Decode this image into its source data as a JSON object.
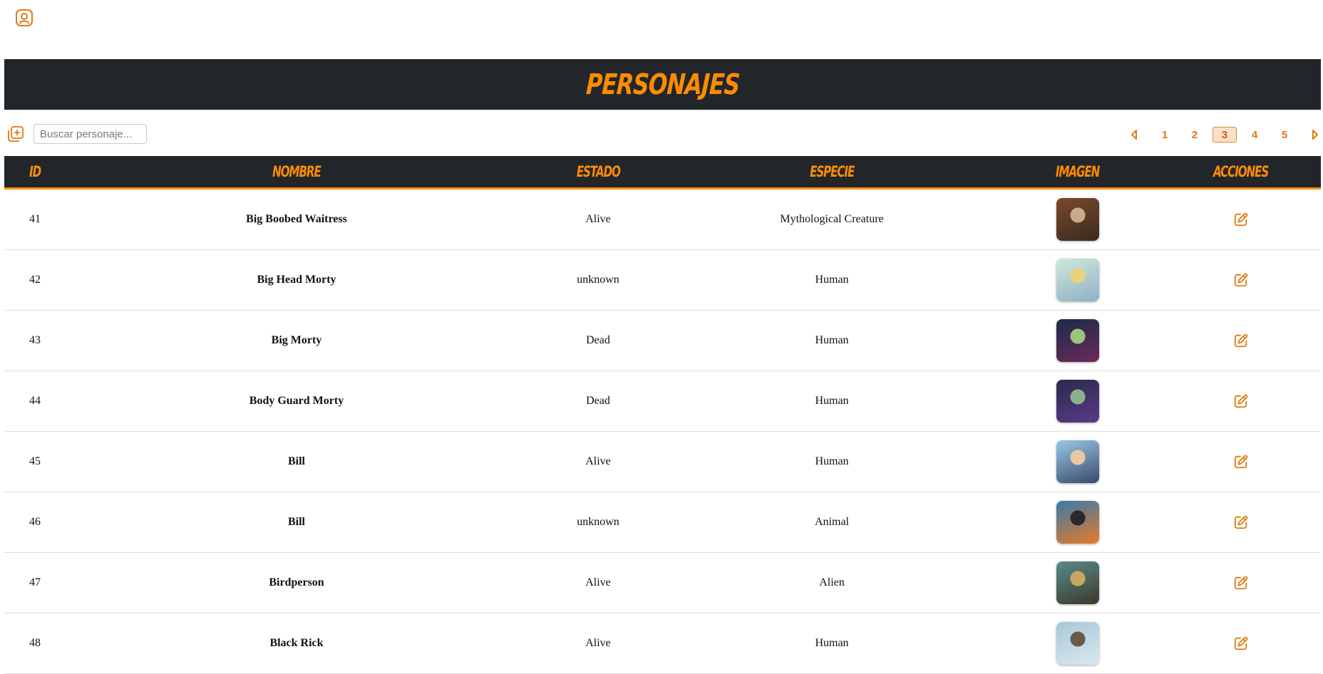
{
  "header": {
    "title": "Personajes"
  },
  "toolbar": {
    "search_placeholder": "Buscar personaje...",
    "search_value": ""
  },
  "pagination": {
    "pages": [
      "1",
      "2",
      "3",
      "4",
      "5"
    ],
    "current": "3"
  },
  "table": {
    "columns": [
      "ID",
      "Nombre",
      "Estado",
      "Especie",
      "Imagen",
      "Acciones"
    ],
    "rows": [
      {
        "id": "41",
        "name": "Big Boobed Waitress",
        "status": "Alive",
        "species": "Mythological Creature",
        "thumb": [
          "#7a4a2a",
          "#c9a98a",
          "#3a2a20"
        ]
      },
      {
        "id": "42",
        "name": "Big Head Morty",
        "status": "unknown",
        "species": "Human",
        "thumb": [
          "#cfe8d8",
          "#e8d27a",
          "#8fb0c9"
        ]
      },
      {
        "id": "43",
        "name": "Big Morty",
        "status": "Dead",
        "species": "Human",
        "thumb": [
          "#1c2a4a",
          "#9ac47a",
          "#6a2a5a"
        ]
      },
      {
        "id": "44",
        "name": "Body Guard Morty",
        "status": "Dead",
        "species": "Human",
        "thumb": [
          "#2a2a4a",
          "#8ab08a",
          "#5a3a8a"
        ]
      },
      {
        "id": "45",
        "name": "Bill",
        "status": "Alive",
        "species": "Human",
        "thumb": [
          "#9ac8e8",
          "#e8c8a0",
          "#3a4a6a"
        ]
      },
      {
        "id": "46",
        "name": "Bill",
        "status": "unknown",
        "species": "Animal",
        "thumb": [
          "#3a7aa8",
          "#2a2a2a",
          "#e87a2a"
        ]
      },
      {
        "id": "47",
        "name": "Birdperson",
        "status": "Alive",
        "species": "Alien",
        "thumb": [
          "#5a8a8a",
          "#c8a860",
          "#3a3a2a"
        ]
      },
      {
        "id": "48",
        "name": "Black Rick",
        "status": "Alive",
        "species": "Human",
        "thumb": [
          "#a8c8d8",
          "#6a5a4a",
          "#d8e8f0"
        ]
      }
    ]
  },
  "colors": {
    "accent": "#ff8c00",
    "icon": "#e07a12",
    "dark": "#22262a"
  },
  "icons": {
    "user": "user-circle-icon",
    "add": "add-square-icon",
    "prev": "caret-left-icon",
    "next": "caret-right-icon",
    "edit": "edit-icon"
  }
}
